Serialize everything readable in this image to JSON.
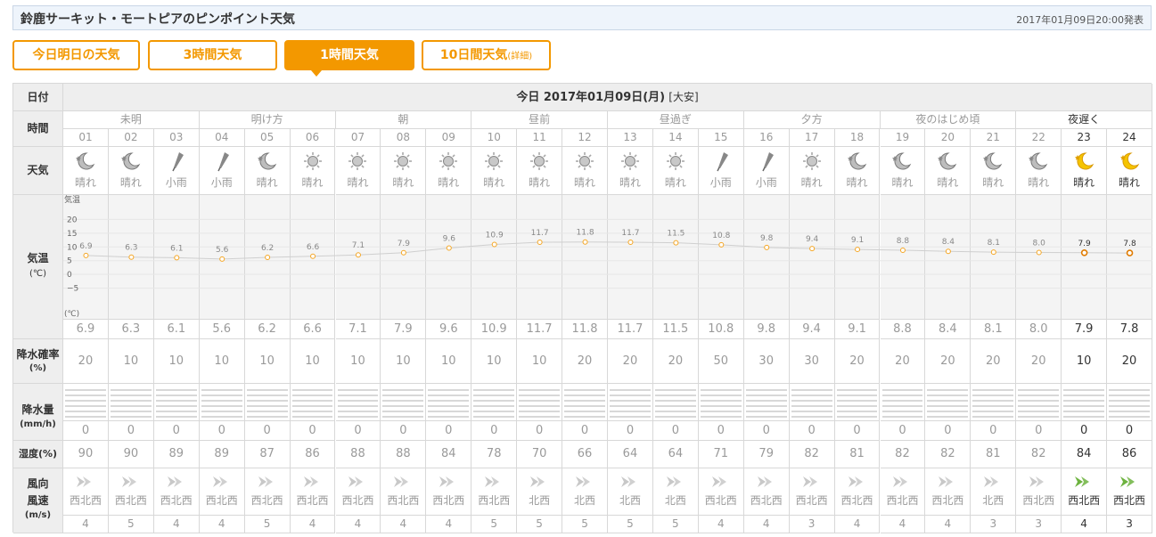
{
  "header": {
    "title": "鈴鹿サーキット・モートピアのピンポイント天気",
    "published": "2017年01月09日20:00発表"
  },
  "tabs": [
    {
      "label": "今日明日の天気",
      "small": "",
      "active": false
    },
    {
      "label": "3時間天気",
      "small": "",
      "active": false
    },
    {
      "label": "1時間天気",
      "small": "",
      "active": true
    },
    {
      "label": "10日間天気",
      "small": "(詳細)",
      "active": false
    }
  ],
  "row_labels": {
    "date": "日付",
    "time": "時間",
    "weather": "天気",
    "temp_main": "気温",
    "temp_unit": "(℃)",
    "precip_prob": "降水確率",
    "precip_prob_unit": "(%)",
    "precip_amount": "降水量",
    "precip_amount_unit": "(mm/h)",
    "humidity": "湿度(%)",
    "wind_dir": "風向",
    "wind_speed": "風速",
    "wind_unit": "(m/s)"
  },
  "date_heading": {
    "text": "今日 2017年01月09日(月)",
    "rokuyo": "[大安]"
  },
  "periods": [
    {
      "label": "未明",
      "span": 3
    },
    {
      "label": "明け方",
      "span": 3
    },
    {
      "label": "朝",
      "span": 3
    },
    {
      "label": "昼前",
      "span": 3
    },
    {
      "label": "昼過ぎ",
      "span": 3
    },
    {
      "label": "夕方",
      "span": 3
    },
    {
      "label": "夜のはじめ頃",
      "span": 3
    },
    {
      "label": "夜遅く",
      "span": 3
    }
  ],
  "hours": [
    "01",
    "02",
    "03",
    "04",
    "05",
    "06",
    "07",
    "08",
    "09",
    "10",
    "11",
    "12",
    "13",
    "14",
    "15",
    "16",
    "17",
    "18",
    "19",
    "20",
    "21",
    "22",
    "23",
    "24"
  ],
  "weather": [
    {
      "icon": "moon-cloud-icon",
      "label": "晴れ"
    },
    {
      "icon": "moon-cloud-icon",
      "label": "晴れ"
    },
    {
      "icon": "umbrella-icon",
      "label": "小雨"
    },
    {
      "icon": "umbrella-icon",
      "label": "小雨"
    },
    {
      "icon": "moon-cloud-icon",
      "label": "晴れ"
    },
    {
      "icon": "sun-icon",
      "label": "晴れ"
    },
    {
      "icon": "sun-icon",
      "label": "晴れ"
    },
    {
      "icon": "sun-icon",
      "label": "晴れ"
    },
    {
      "icon": "sun-icon",
      "label": "晴れ"
    },
    {
      "icon": "sun-icon",
      "label": "晴れ"
    },
    {
      "icon": "sun-icon",
      "label": "晴れ"
    },
    {
      "icon": "sun-icon",
      "label": "晴れ"
    },
    {
      "icon": "sun-icon",
      "label": "晴れ"
    },
    {
      "icon": "sun-icon",
      "label": "晴れ"
    },
    {
      "icon": "umbrella-icon",
      "label": "小雨"
    },
    {
      "icon": "umbrella-icon",
      "label": "小雨"
    },
    {
      "icon": "sun-icon",
      "label": "晴れ"
    },
    {
      "icon": "moon-cloud-icon",
      "label": "晴れ"
    },
    {
      "icon": "moon-cloud-icon",
      "label": "晴れ"
    },
    {
      "icon": "moon-cloud-icon",
      "label": "晴れ"
    },
    {
      "icon": "moon-cloud-icon",
      "label": "晴れ"
    },
    {
      "icon": "moon-cloud-icon",
      "label": "晴れ"
    },
    {
      "icon": "moon-icon",
      "label": "晴れ"
    },
    {
      "icon": "moon-icon",
      "label": "晴れ"
    }
  ],
  "chart_data": {
    "type": "line",
    "title": "",
    "ylabel": "気温 (℃)",
    "axis_top_label": "気温",
    "axis_bottom_label": "(℃)",
    "ylim": [
      -10,
      25
    ],
    "yticks": [
      "20",
      "15",
      "10",
      "5",
      "0",
      "−5"
    ],
    "ytick_values": [
      20,
      15,
      10,
      5,
      0,
      -5
    ],
    "x": [
      "01",
      "02",
      "03",
      "04",
      "05",
      "06",
      "07",
      "08",
      "09",
      "10",
      "11",
      "12",
      "13",
      "14",
      "15",
      "16",
      "17",
      "18",
      "19",
      "20",
      "21",
      "22",
      "23",
      "24"
    ],
    "values": [
      6.9,
      6.3,
      6.1,
      5.6,
      6.2,
      6.6,
      7.1,
      7.9,
      9.6,
      10.9,
      11.7,
      11.8,
      11.7,
      11.5,
      10.8,
      9.8,
      9.4,
      9.1,
      8.8,
      8.4,
      8.1,
      8.0,
      7.9,
      7.8
    ],
    "labels": [
      "6.9",
      "6.3",
      "6.1",
      "5.6",
      "6.2",
      "6.6",
      "7.1",
      "7.9",
      "9.6",
      "10.9",
      "11.7",
      "11.8",
      "11.7",
      "11.5",
      "10.8",
      "9.8",
      "9.4",
      "9.1",
      "8.8",
      "8.4",
      "8.1",
      "8.0",
      "7.9",
      "7.8"
    ],
    "grid": true,
    "point_color": "#f5a623",
    "highlight_color": "#e07b00"
  },
  "temps": [
    "6.9",
    "6.3",
    "6.1",
    "5.6",
    "6.2",
    "6.6",
    "7.1",
    "7.9",
    "9.6",
    "10.9",
    "11.7",
    "11.8",
    "11.7",
    "11.5",
    "10.8",
    "9.8",
    "9.4",
    "9.1",
    "8.8",
    "8.4",
    "8.1",
    "8.0",
    "7.9",
    "7.8"
  ],
  "precip_prob": [
    "20",
    "10",
    "10",
    "10",
    "10",
    "10",
    "10",
    "10",
    "10",
    "10",
    "10",
    "20",
    "20",
    "20",
    "50",
    "30",
    "30",
    "20",
    "20",
    "20",
    "20",
    "20",
    "10",
    "20"
  ],
  "precip_amount": [
    "0",
    "0",
    "0",
    "0",
    "0",
    "0",
    "0",
    "0",
    "0",
    "0",
    "0",
    "0",
    "0",
    "0",
    "0",
    "0",
    "0",
    "0",
    "0",
    "0",
    "0",
    "0",
    "0",
    "0"
  ],
  "humidity": [
    "90",
    "90",
    "89",
    "89",
    "87",
    "86",
    "88",
    "88",
    "84",
    "78",
    "70",
    "66",
    "64",
    "64",
    "71",
    "79",
    "82",
    "81",
    "82",
    "82",
    "81",
    "82",
    "84",
    "86"
  ],
  "wind_dir": [
    "西北西",
    "西北西",
    "西北西",
    "西北西",
    "西北西",
    "西北西",
    "西北西",
    "西北西",
    "西北西",
    "西北西",
    "北西",
    "北西",
    "北西",
    "北西",
    "西北西",
    "西北西",
    "西北西",
    "西北西",
    "西北西",
    "西北西",
    "北西",
    "西北西",
    "西北西",
    "西北西"
  ],
  "wind_speed": [
    "4",
    "5",
    "4",
    "4",
    "5",
    "4",
    "4",
    "4",
    "4",
    "5",
    "5",
    "5",
    "5",
    "5",
    "4",
    "4",
    "3",
    "4",
    "4",
    "4",
    "3",
    "3",
    "4",
    "3"
  ],
  "colors": {
    "accent": "#f39800",
    "active_wind": "#6db33f",
    "wind_gray": "#c8c8c8"
  }
}
